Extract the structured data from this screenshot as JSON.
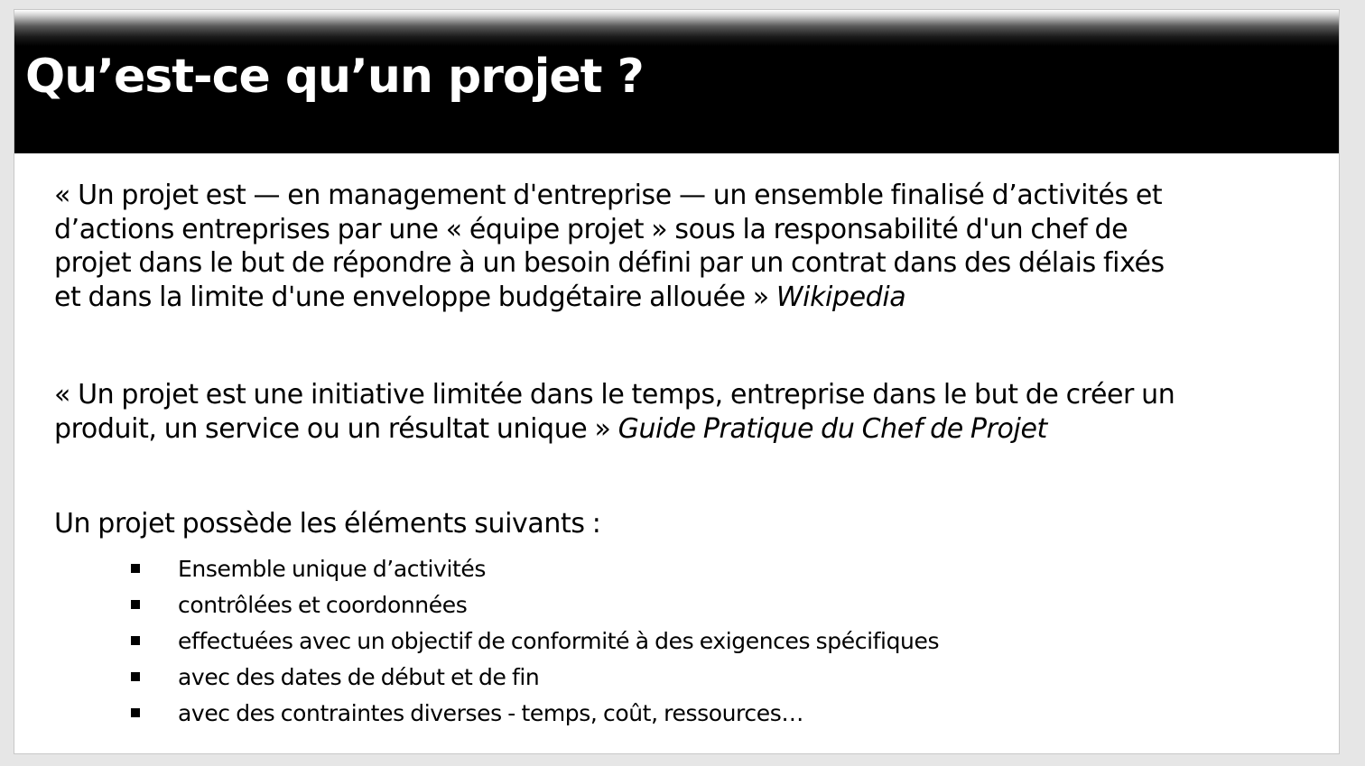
{
  "slide": {
    "title": "Qu’est-ce qu’un projet ?",
    "definition_1": {
      "lines": [
        "« Un projet est — en management d'entreprise — un ensemble finalisé d’activités et",
        "d’actions entreprises par une « équipe projet » sous la responsabilité d'un chef de",
        "projet dans le but de répondre à un besoin défini par un contrat dans des délais fixés",
        "et dans la limite d'une enveloppe budgétaire allouée » "
      ],
      "source": "Wikipedia"
    },
    "definition_2": {
      "lines": [
        "« Un projet est une initiative limitée dans le temps, entreprise dans le but de créer un",
        "produit, un service ou un résultat unique » "
      ],
      "source": "Guide Pratique du Chef de Projet"
    },
    "elements_intro": "Un projet possède les éléments suivants :",
    "elements": [
      "Ensemble unique d’activités",
      "contrôlées et coordonnées",
      "effectuées avec un objectif de conformité à des exigences spécifiques",
      "avec des dates de début et de fin",
      "avec des contraintes diverses - temps, coût, ressources…"
    ]
  }
}
